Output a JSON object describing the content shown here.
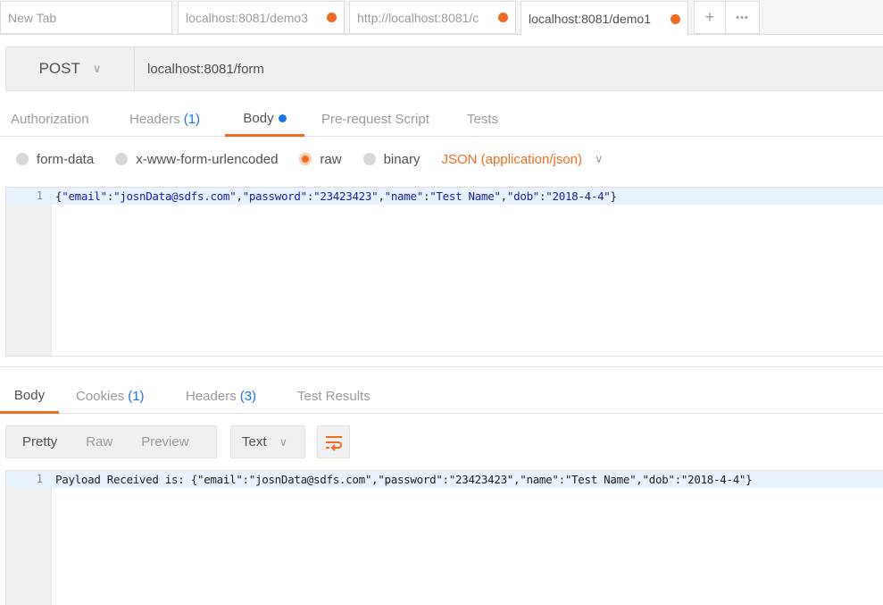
{
  "tabs": [
    {
      "label": "New Tab",
      "unsaved": false
    },
    {
      "label": "localhost:8081/demo3",
      "unsaved": true
    },
    {
      "label": "http://localhost:8081/c",
      "unsaved": true
    },
    {
      "label": "localhost:8081/demo1",
      "unsaved": true,
      "active": true
    }
  ],
  "tab_actions": {
    "add": "+",
    "more": "•••"
  },
  "request": {
    "method": "POST",
    "url": "localhost:8081/form"
  },
  "request_tabs": [
    {
      "label": "Authorization"
    },
    {
      "label": "Headers",
      "count": "(1)"
    },
    {
      "label": "Body",
      "active": true
    },
    {
      "label": "Pre-request Script"
    },
    {
      "label": "Tests"
    }
  ],
  "body_modes": [
    {
      "label": "form-data",
      "selected": false
    },
    {
      "label": "x-www-form-urlencoded",
      "selected": false
    },
    {
      "label": "raw",
      "selected": true
    },
    {
      "label": "binary",
      "selected": false
    }
  ],
  "content_type": "JSON (application/json)",
  "request_body": {
    "line_number": "1",
    "code": "{\"email\":\"josnData@sdfs.com\",\"password\":\"23423423\",\"name\":\"Test Name\",\"dob\":\"2018-4-4\"}"
  },
  "response_tabs": [
    {
      "label": "Body",
      "active": true
    },
    {
      "label": "Cookies",
      "count": "(1)"
    },
    {
      "label": "Headers",
      "count": "(3)"
    },
    {
      "label": "Test Results"
    }
  ],
  "view_modes": [
    "Pretty",
    "Raw",
    "Preview"
  ],
  "format": "Text",
  "response_body": {
    "line_number": "1",
    "code": "Payload Received is: {\"email\":\"josnData@sdfs.com\",\"password\":\"23423423\",\"name\":\"Test Name\",\"dob\":\"2018-4-4\"}"
  },
  "colors": {
    "accent": "#f26b21",
    "count": "#1a73e8",
    "string": "#1a1aa6"
  }
}
